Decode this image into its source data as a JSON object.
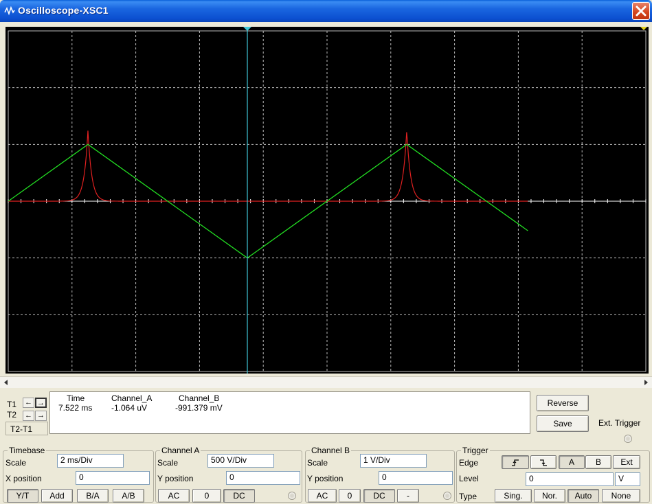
{
  "window": {
    "title": "Oscilloscope-XSC1"
  },
  "colors": {
    "channel_a": "#e02020",
    "channel_b": "#22dd22",
    "cursor_t1": "#40c8d8",
    "cursor_t2": "#e0d020",
    "grid": "#bdbdbd"
  },
  "chart_data": {
    "type": "line",
    "grid": true,
    "divisions": {
      "x": 10,
      "y": 6
    },
    "time_per_div_ms": 2,
    "series": [
      {
        "name": "Channel_B",
        "color": "#22dd22",
        "x_ms": [
          0,
          2.5,
          7.5,
          12.5,
          16.3
        ],
        "y_div": [
          0,
          1,
          -1,
          1,
          -0.52
        ]
      },
      {
        "name": "Channel_A",
        "color": "#e02020",
        "spike_times_ms": [
          2.5,
          12.5
        ],
        "spike_peak_div": 1.25,
        "x_end_ms": 16.3
      }
    ],
    "cursor_t1_ms": 7.5
  },
  "readout": {
    "t1_label": "T1",
    "t2_label": "T2",
    "t2t1_label": "T2-T1",
    "headers": [
      "Time",
      "Channel_A",
      "Channel_B"
    ],
    "row1": [
      "7.522 ms",
      "-1.064 uV",
      "-991.379 mV"
    ]
  },
  "side_buttons": {
    "reverse": "Reverse",
    "save": "Save",
    "ext_trigger": "Ext. Trigger"
  },
  "timebase": {
    "title": "Timebase",
    "scale_label": "Scale",
    "scale_value": "2 ms/Div",
    "xpos_label": "X position",
    "xpos_value": "0",
    "modes": [
      "Y/T",
      "Add",
      "B/A",
      "A/B"
    ]
  },
  "channel_a": {
    "title": "Channel A",
    "scale_label": "Scale",
    "scale_value": "500  V/Div",
    "ypos_label": "Y position",
    "ypos_value": "0",
    "coupling": [
      "AC",
      "0",
      "DC"
    ]
  },
  "channel_b": {
    "title": "Channel B",
    "scale_label": "Scale",
    "scale_value": "1  V/Div",
    "ypos_label": "Y position",
    "ypos_value": "0",
    "coupling": [
      "AC",
      "0",
      "DC",
      "-"
    ]
  },
  "trigger": {
    "title": "Trigger",
    "edge_label": "Edge",
    "level_label": "Level",
    "type_label": "Type",
    "sources": [
      "A",
      "B",
      "Ext"
    ],
    "level_value": "0",
    "level_unit": "V",
    "types": [
      "Sing.",
      "Nor.",
      "Auto",
      "None"
    ]
  }
}
